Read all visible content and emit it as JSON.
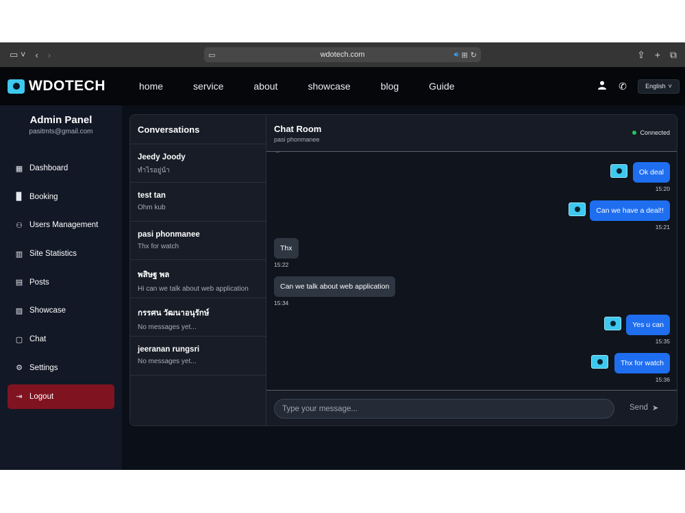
{
  "browser": {
    "url": "wdotech.com"
  },
  "header": {
    "logo_text": "WDOTECH",
    "nav": [
      "home",
      "service",
      "about",
      "showcase",
      "blog",
      "Guide"
    ],
    "language": "English"
  },
  "sidebar": {
    "title": "Admin Panel",
    "email": "pasitmts@gmail.com",
    "items": [
      {
        "label": "Dashboard",
        "icon": "grid-icon"
      },
      {
        "label": "Booking",
        "icon": "book-icon"
      },
      {
        "label": "Users Management",
        "icon": "users-icon"
      },
      {
        "label": "Site Statistics",
        "icon": "bar-chart-icon"
      },
      {
        "label": "Posts",
        "icon": "document-icon"
      },
      {
        "label": "Showcase",
        "icon": "image-icon"
      },
      {
        "label": "Chat",
        "icon": "chat-icon"
      },
      {
        "label": "Settings",
        "icon": "gear-icon"
      },
      {
        "label": "Logout",
        "icon": "logout-icon"
      }
    ]
  },
  "conversations": {
    "title": "Conversations",
    "items": [
      {
        "name": "Jeedy Joody",
        "last": "ทำไรอยู่น้า"
      },
      {
        "name": "test tan",
        "last": "Ohm kub"
      },
      {
        "name": "pasi phonmanee",
        "last": "Thx for watch"
      },
      {
        "name": "พสิษฐ พล",
        "last": "Hi can we talk about web application"
      },
      {
        "name": "กรรศน วัฒนาอนุรักษ์",
        "last": "No messages yet..."
      },
      {
        "name": "jeeranan rungsri",
        "last": "No messages yet..."
      }
    ]
  },
  "chat": {
    "title": "Chat Room",
    "subtitle": "pasi phonmanee",
    "status": "Connected",
    "messages": [
      {
        "text": "Ok deal",
        "time": "15:20",
        "dir": "out"
      },
      {
        "text": "Can we have a deal!!",
        "time": "15:21",
        "dir": "out"
      },
      {
        "text": "Thx",
        "time": "15:22",
        "dir": "in"
      },
      {
        "text": "Can we talk about web application",
        "time": "15:34",
        "dir": "in"
      },
      {
        "text": "Yes u can",
        "time": "15:35",
        "dir": "out"
      },
      {
        "text": "Thx for watch",
        "time": "15:36",
        "dir": "out"
      }
    ],
    "input_placeholder": "Type your message...",
    "send_label": "Send"
  },
  "colors": {
    "accent": "#1f6ef0",
    "logo": "#3ec8ee",
    "logout": "#7f1420",
    "connected": "#22c55e"
  }
}
